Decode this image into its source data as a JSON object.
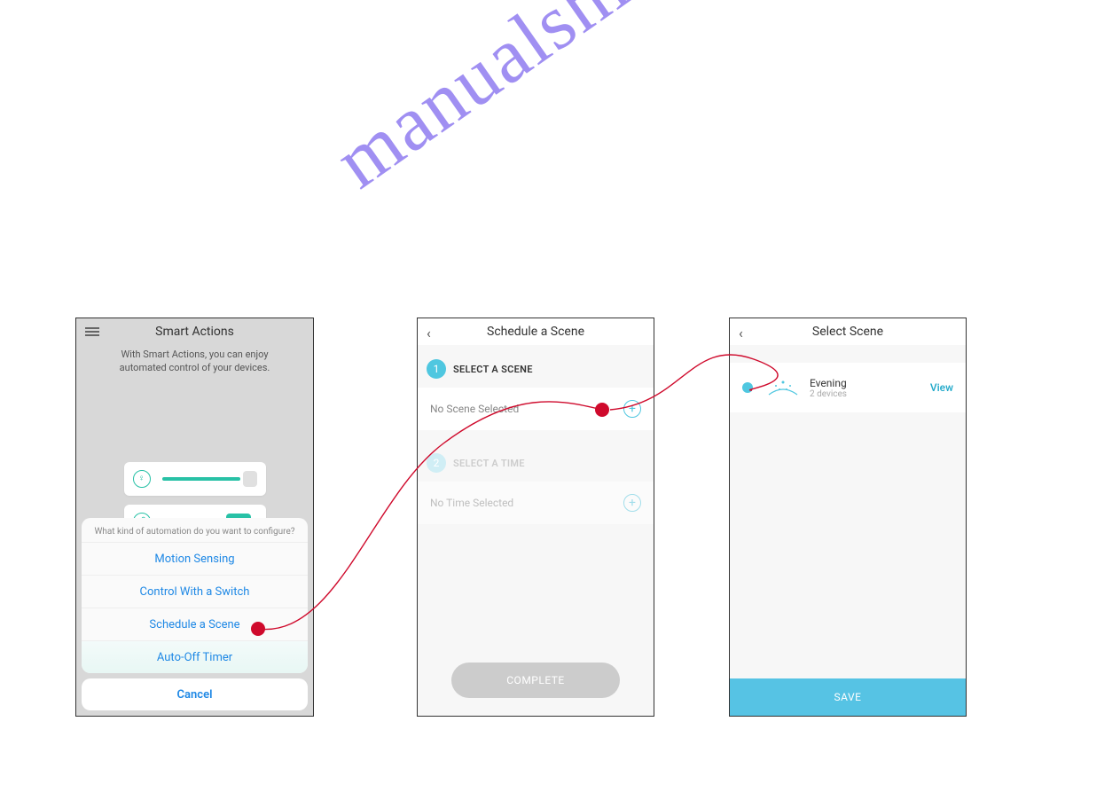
{
  "watermark": "manualshive.com",
  "phone1": {
    "title": "Smart Actions",
    "subtitle": "With Smart Actions, you can enjoy automated control of your devices.",
    "sheet_question": "What kind of automation do you want to configure?",
    "options": {
      "motion": "Motion Sensing",
      "switch": "Control With a Switch",
      "schedule": "Schedule a Scene",
      "auto_off": "Auto-Off Timer"
    },
    "cancel": "Cancel"
  },
  "phone2": {
    "title": "Schedule a Scene",
    "step1_label": "SELECT A SCENE",
    "step1_value": "No Scene Selected",
    "step2_label": "SELECT A TIME",
    "step2_value": "No Time Selected",
    "complete": "COMPLETE"
  },
  "phone3": {
    "title": "Select Scene",
    "scene_name": "Evening",
    "scene_sub": "2 devices",
    "view": "View",
    "save": "SAVE"
  }
}
